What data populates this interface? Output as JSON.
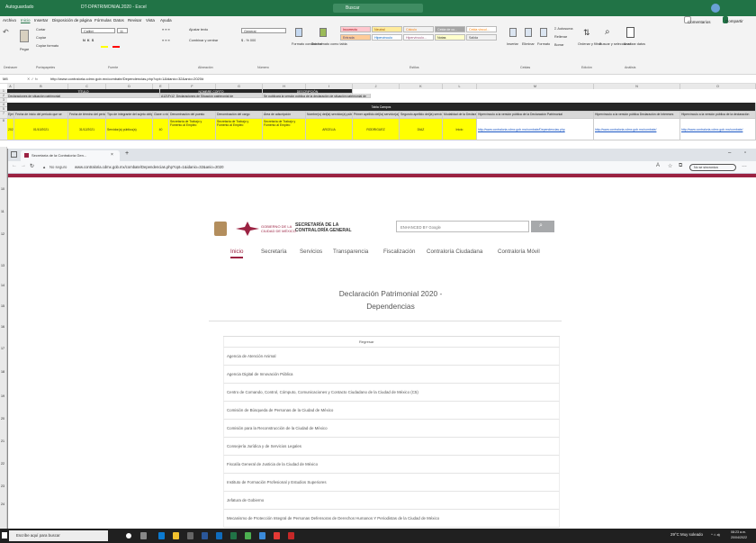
{
  "excel": {
    "title_left": "Autoguardado",
    "file_name": "DT-DPATRIMONIAL2020 - Excel",
    "search_placeholder": "Buscar",
    "menu": [
      "Archivo",
      "Inicio",
      "Insertar",
      "Disposición de página",
      "Fórmulas",
      "Datos",
      "Revisar",
      "Vista",
      "Ayuda"
    ],
    "comments_btn": "Comentarios",
    "share_btn": "Compartir",
    "ribbon": {
      "paste": "Pegar",
      "cut": "Cortar",
      "copy": "Copiar",
      "format_painter": "Copiar formato",
      "font_name": "Calibri",
      "font_size": "11",
      "wrap": "Ajustar texto",
      "merge": "Combinar y centrar",
      "number_format": "General",
      "cond_format": "Formato condicional",
      "table_format": "Dar formato como tabla",
      "styles": [
        "Incorrecto",
        "Neutral",
        "Cálculo",
        "Celda de co...",
        "Celda vincul...",
        "Entrada",
        "Hipervínculo",
        "Hipervínculo...",
        "Notas",
        "Salida"
      ],
      "insert": "Insertar",
      "delete": "Eliminar",
      "format": "Formato",
      "autosum": "Autosuma",
      "fill": "Rellenar",
      "clear": "Borrar",
      "sort": "Ordenar y filtrar",
      "find": "Buscar y seleccionar",
      "analyze": "Analizar datos",
      "groups": [
        "Deshacer",
        "Portapapeles",
        "Fuente",
        "Alineación",
        "Número",
        "Estilos",
        "Celdas",
        "Edición",
        "Análisis"
      ]
    },
    "name_box": "M8",
    "formula": "http://www.contraloria.cdmx.gob.mx/combate/Dependencias.php?opt=1&idanio=32&anio=2020#",
    "columns": [
      "A",
      "B",
      "C",
      "D",
      "E",
      "F",
      "G",
      "H",
      "I",
      "J",
      "K",
      "L",
      "M",
      "N",
      "O"
    ],
    "rows": [
      "1",
      "2",
      "3",
      "4",
      "5",
      "6",
      "7",
      "8",
      "9",
      "10",
      "11",
      "12",
      "13",
      "14",
      "15",
      "16",
      "17",
      "18",
      "19",
      "20",
      "21",
      "22",
      "23",
      "24",
      "25",
      "26"
    ],
    "cells": {
      "titulo": "TÍTULO",
      "nombre_corto": "NOMBRE CORTO",
      "descripcion": "DESCRIPCIÓN",
      "r3a": "Declaraciones de situación patrimonial",
      "r3b": "A121Fr12_Declaraciones de Situación patrimonial de",
      "r3c": "Se publicará la versión pública de la declaración de situación patrimonial de",
      "tabla_campos": "Tabla Campos",
      "h": [
        "Ejercicio",
        "Fecha de inicio del periodo que se",
        "Fecha de término del periodo que se",
        "Tipo de integrante del sujeto obligado",
        "Clave o nivel del",
        "Denominación del puesto",
        "Denominación del cargo",
        "Área de adscripción",
        "Nombre(s) del(la) servidor(a) público(a)",
        "Primer apellido del(la) servidor(a) público(a)",
        "Segundo apellido del(la) servidor(a)",
        "Modalidad de la Declaración",
        "Hipervínculo a la versión pública de la Declaración Patrimonial",
        "Hipervínculo a la versión pública Declaración de Intereses",
        "Hipervínculo a la versión pública de la declaración"
      ],
      "d": [
        "2021",
        "01/10/2021",
        "31/12/2021",
        "Servidor(a) público(a)",
        "40",
        "Secretaría de Trabajo y Fomento al Empleo",
        "Secretaría de Trabajo y Fomento al Empleo",
        "Secretaría de Trabajo y Fomento al Empleo",
        "ARCELIA",
        "RODRIGUEZ",
        "DIAZ",
        "Inicio",
        "http://www.contraloria.cdmx.gob.mx/combate/Dependencias.php",
        "http://www.contraloria.cdmx.gob.mx/combate/",
        "http://www.contraloria.cdmx.gob.mx/combate/"
      ]
    }
  },
  "browser": {
    "tab_title": "Secretaría de la Contraloría Gen...",
    "not_secure": "No seguro",
    "url": "www.contraloria.cdmx.gob.mx/combate/Dependencias.php?opt=1&idanio=32&anio=2020",
    "sites_btn": "No se sincroniza"
  },
  "site": {
    "logo_gov": "GOBIERNO DE LA CIUDAD DE MÉXICO",
    "logo_secretaria": "SECRETARÍA DE LA CONTRALORÍA GENERAL",
    "search_placeholder": "ENHANCED BY Google",
    "nav": [
      "Inicio",
      "Secretaría",
      "Servicios",
      "Transparencia",
      "Fiscalización",
      "Contraloría Ciudadana",
      "Contraloría Móvil"
    ],
    "title_line1": "Declaración Patrimonial 2020 -",
    "title_line2": "Dependencias",
    "regresar": "Regresar",
    "dependencias": [
      "Agencia de Atención Animal",
      "Agencia Digital de Innovación Pública",
      "Centro de Comando, Control, Cómputo, Comunicaciones y Contacto Ciudadano de la Ciudad de México (C5)",
      "Comisión de Búsqueda de Personas de la Ciudad de México",
      "Comisión para la Reconstrucción de la Ciudad de México",
      "Consejería Jurídica y de Servicios Legales",
      "Fiscalía General de Justicia de la Ciudad de México",
      "Instituto de Formación Profesional y Estudios Superiores",
      "Jefatura de Gobierno",
      "Mecanismo de Protección Integral de Personas Defensoras de Derechos Humanos Y Periodistas de la Ciudad de México"
    ]
  },
  "taskbar": {
    "search_placeholder": "Escribe aquí para buscar",
    "weather": "29°C Muy soleado",
    "time": "08:23 a.m.",
    "date": "20/04/2022",
    "lang": "ESP"
  }
}
